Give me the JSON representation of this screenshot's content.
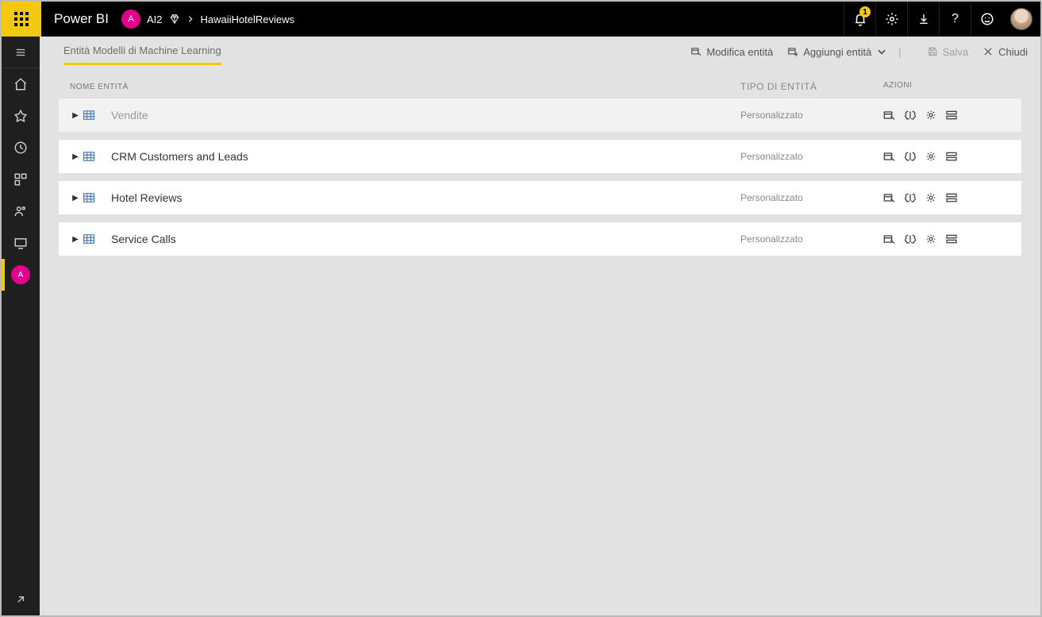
{
  "header": {
    "brand": "Power BI",
    "workspace_initial": "A",
    "workspace_name": "AI2",
    "breadcrumb": "HawaiiHotelReviews",
    "notification_count": "1"
  },
  "leftnav": {
    "workspace_initial": "A"
  },
  "toolbar": {
    "tab_label": "Entità Modelli di Machine Learning",
    "edit_label": "Modifica entità",
    "add_label": "Aggiungi entità",
    "save_label": "Salva",
    "close_label": "Chiudi"
  },
  "table": {
    "headers": {
      "name": "NOME ENTITÀ",
      "type": "TIPO DI ENTITÀ",
      "actions": "AZIONI"
    },
    "rows": [
      {
        "name": "Vendite",
        "type": "Personalizzato"
      },
      {
        "name": "CRM Customers and Leads",
        "type": "Personalizzato"
      },
      {
        "name": "Hotel Reviews",
        "type": "Personalizzato"
      },
      {
        "name": "Service Calls",
        "type": "Personalizzato"
      }
    ]
  }
}
